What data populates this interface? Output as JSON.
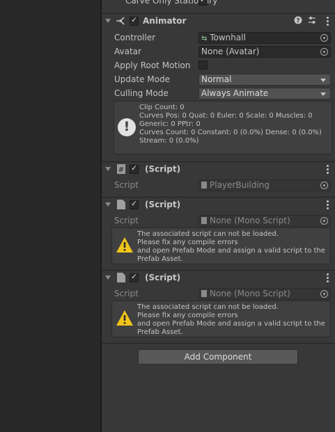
{
  "top_row": {
    "label": "Carve Only Stationary",
    "checked": true
  },
  "animator": {
    "title": "Animator",
    "help_icon": "help-icon",
    "settings_icon": "preset-icon",
    "controller": {
      "label": "Controller",
      "value": "Townhall"
    },
    "avatar": {
      "label": "Avatar",
      "value": "None (Avatar)"
    },
    "apply_root_motion": {
      "label": "Apply Root Motion",
      "checked": false
    },
    "update_mode": {
      "label": "Update Mode",
      "value": "Normal"
    },
    "culling_mode": {
      "label": "Culling Mode",
      "value": "Always Animate"
    },
    "info_lines": [
      "Clip Count: 0",
      "Curves Pos: 0 Quat: 0 Euler: 0 Scale: 0 Muscles: 0",
      "Generic: 0 PPtr: 0",
      "Curves Count: 0 Constant: 0 (0.0%) Dense: 0 (0.0%)",
      "Stream: 0 (0.0%)"
    ]
  },
  "script1": {
    "title": "(Script)",
    "field_label": "Script",
    "value": "PlayerBuilding"
  },
  "script2": {
    "title": "(Script)",
    "field_label": "Script",
    "value": "None (Mono Script)",
    "warning_lines": [
      "The associated script can not be loaded.",
      "Please fix any compile errors",
      "and open Prefab Mode and assign a valid script to the",
      "Prefab Asset."
    ]
  },
  "script3": {
    "title": "(Script)",
    "field_label": "Script",
    "value": "None (Mono Script)",
    "warning_lines": [
      "The associated script can not be loaded.",
      "Please fix any compile errors",
      "and open Prefab Mode and assign a valid script to the",
      "Prefab Asset."
    ]
  },
  "add_component_label": "Add Component",
  "colors": {
    "background": "#383838",
    "warning": "#f0c419",
    "field": "#2a2a2a"
  }
}
